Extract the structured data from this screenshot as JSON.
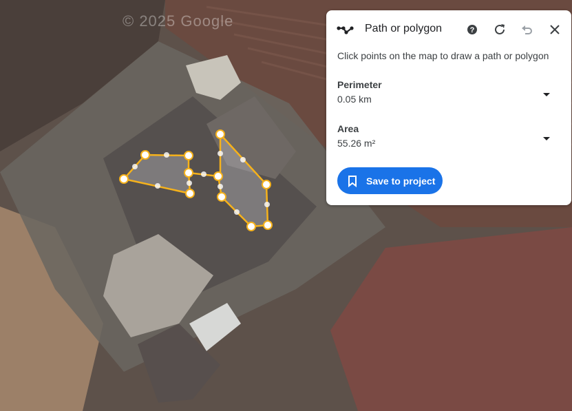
{
  "map": {
    "watermark": "© 2025 Google"
  },
  "panel": {
    "title": "Path or polygon",
    "instruction": "Click points on the map to draw a path or polygon",
    "perimeter": {
      "label": "Perimeter",
      "value": "0.05 km"
    },
    "area": {
      "label": "Area",
      "value": "55.26 m²"
    },
    "save_label": "Save to project"
  },
  "colors": {
    "accent": "#1a73e8",
    "polygon_stroke": "#f6b21b",
    "vertex_fill": "#ffffff"
  }
}
